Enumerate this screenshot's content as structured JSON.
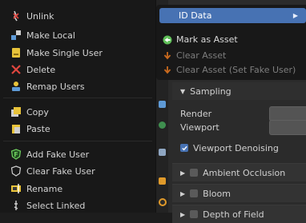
{
  "context_menu": {
    "items": [
      {
        "label": "Unlink",
        "icon": "unlink-icon"
      },
      {
        "label": "Make Local",
        "icon": "make-local-icon"
      },
      {
        "label": "Make Single User",
        "icon": "make-single-user-icon"
      },
      {
        "label": "Delete",
        "icon": "delete-icon"
      },
      {
        "label": "Remap Users",
        "icon": "remap-users-icon"
      },
      {
        "label": "Copy",
        "icon": "copy-icon"
      },
      {
        "label": "Paste",
        "icon": "paste-icon"
      },
      {
        "label": "Add Fake User",
        "icon": "fake-user-add-icon"
      },
      {
        "label": "Clear Fake User",
        "icon": "fake-user-clear-icon"
      },
      {
        "label": "Rename",
        "icon": "rename-icon"
      },
      {
        "label": "Select Linked",
        "icon": "select-linked-icon"
      }
    ]
  },
  "submenu": {
    "title": "ID Data",
    "items": [
      {
        "label": "Mark as Asset",
        "icon": "mark-asset-icon",
        "enabled": true
      },
      {
        "label": "Clear Asset",
        "icon": "clear-asset-icon",
        "enabled": false
      },
      {
        "label": "Clear Asset (Set Fake User)",
        "icon": "clear-asset-fake-user-icon",
        "enabled": false
      }
    ]
  },
  "properties": {
    "sampling_label": "Sampling",
    "render_label": "Render",
    "viewport_label": "Viewport",
    "viewport_denoising_label": "Viewport Denoising",
    "viewport_denoising_checked": true,
    "ambient_occlusion_label": "Ambient Occlusion",
    "bloom_label": "Bloom",
    "depth_of_field_label": "Depth of Field"
  },
  "colors": {
    "menu_bg": "#181818",
    "highlight": "#4772b3",
    "panel_bg": "#2b2b2b"
  }
}
